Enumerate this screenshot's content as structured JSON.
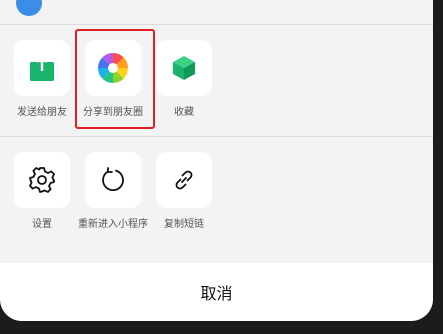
{
  "share_sheet": {
    "row1": [
      {
        "label": "发送给朋友",
        "icon": "share-upload-icon"
      },
      {
        "label": "分享到朋友圈",
        "icon": "moments-aperture-icon"
      },
      {
        "label": "收藏",
        "icon": "favorites-cube-icon"
      }
    ],
    "row2": [
      {
        "label": "设置",
        "icon": "gear-icon"
      },
      {
        "label": "重新进入小程序",
        "icon": "refresh-icon"
      },
      {
        "label": "复制短链",
        "icon": "link-icon"
      }
    ],
    "cancel_label": "取消"
  },
  "colors": {
    "accent_green": "#19b36b",
    "highlight_red": "#e0201f"
  }
}
